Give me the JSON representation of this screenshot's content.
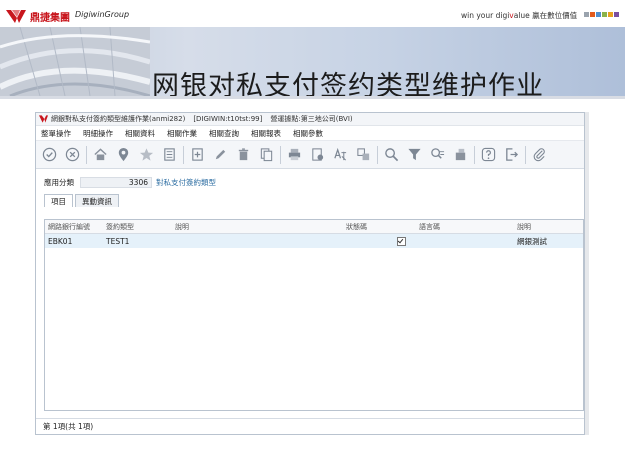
{
  "slide": {
    "logo_cn": "鼎捷集團",
    "logo_en": "DigiwinGroup",
    "tagline_pre": "win your digi",
    "tagline_v": "v",
    "tagline_post": "alue 贏在數位價值",
    "title": "网银对私支付签约类型维护作业",
    "accent_squares": [
      "#9aa3ad",
      "#e25a1c",
      "#4f8fcf",
      "#8ab34a",
      "#e8a11f",
      "#7a4ea0"
    ]
  },
  "window": {
    "title": "網銀對私支付簽約類型維護作業(anmi282)",
    "env": "[DIGIWIN:t10tst:99]",
    "org": "營運據點:第三地公司(BVI)"
  },
  "menu": [
    "整單操作",
    "明細操作",
    "相關資料",
    "相關作業",
    "相關查詢",
    "相關報表",
    "相關參數"
  ],
  "toolbar": {
    "icons": [
      "confirm-icon",
      "cancel-icon",
      "home-icon",
      "locate-icon",
      "favorite-icon",
      "list-icon",
      "add-icon",
      "edit-icon",
      "delete-icon",
      "copy-icon",
      "print-icon",
      "export-icon",
      "translate-icon",
      "report-icon",
      "search-icon",
      "filter-icon",
      "query-icon",
      "tag-icon",
      "help-icon",
      "exit-icon",
      "attachment-icon"
    ]
  },
  "filter": {
    "label": "應用分類",
    "value": "3306",
    "description": "對私支付簽約類型"
  },
  "tabs": [
    {
      "label": "項目",
      "active": true
    },
    {
      "label": "異動資訊",
      "active": false
    }
  ],
  "grid": {
    "columns": [
      "網路銀行編號",
      "簽約類型",
      "說明",
      "狀態碼",
      "",
      "語言碼",
      "說明"
    ],
    "rows": [
      {
        "bank_no": "EBK01",
        "type": "TEST1",
        "desc": "",
        "status_checked": true,
        "lang": "",
        "lang_desc": "網銀測試"
      }
    ]
  },
  "status": {
    "text": "第    1項(共    1項)"
  }
}
